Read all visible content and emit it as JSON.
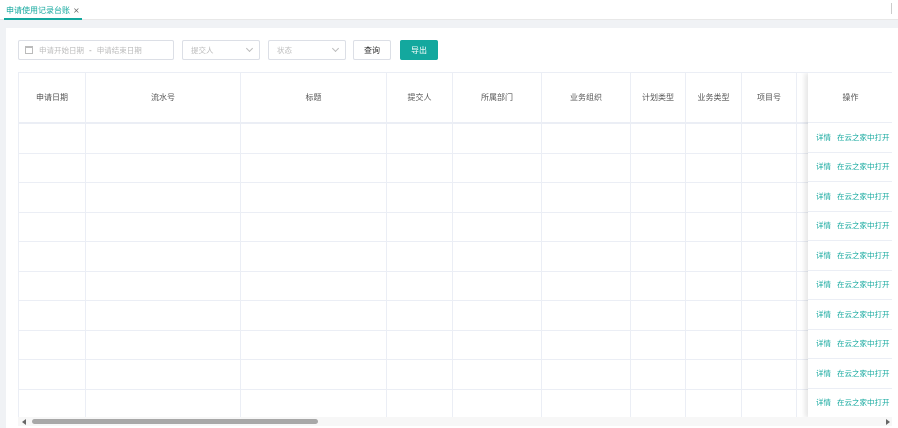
{
  "tab": {
    "label": "申请使用记录台账",
    "close": "×"
  },
  "filters": {
    "start_date_placeholder": "申请开始日期",
    "range_separator": "-",
    "end_date_placeholder": "申请结束日期",
    "submitter_placeholder": "提交人",
    "status_placeholder": "状态"
  },
  "buttons": {
    "query": "查询",
    "export": "导出"
  },
  "table": {
    "columns": [
      "申请日期",
      "流水号",
      "标题",
      "提交人",
      "所属部门",
      "业务组织",
      "计划类型",
      "业务类型",
      "项目号",
      ""
    ],
    "fixed_column_header": "操作",
    "rows": [
      {
        "detail": "详情",
        "open": "在云之家中打开"
      },
      {
        "detail": "详情",
        "open": "在云之家中打开"
      },
      {
        "detail": "详情",
        "open": "在云之家中打开"
      },
      {
        "detail": "详情",
        "open": "在云之家中打开"
      },
      {
        "detail": "详情",
        "open": "在云之家中打开"
      },
      {
        "detail": "详情",
        "open": "在云之家中打开"
      },
      {
        "detail": "详情",
        "open": "在云之家中打开"
      },
      {
        "detail": "详情",
        "open": "在云之家中打开"
      },
      {
        "detail": "详情",
        "open": "在云之家中打开"
      },
      {
        "detail": "详情",
        "open": "在云之家中打开"
      }
    ]
  },
  "colors": {
    "accent": "#13a89e",
    "border": "#ebeef5"
  },
  "icons": [
    "calendar-icon",
    "chevron-down-icon",
    "close-icon",
    "scroll-left-arrow-icon",
    "scroll-right-arrow-icon"
  ]
}
